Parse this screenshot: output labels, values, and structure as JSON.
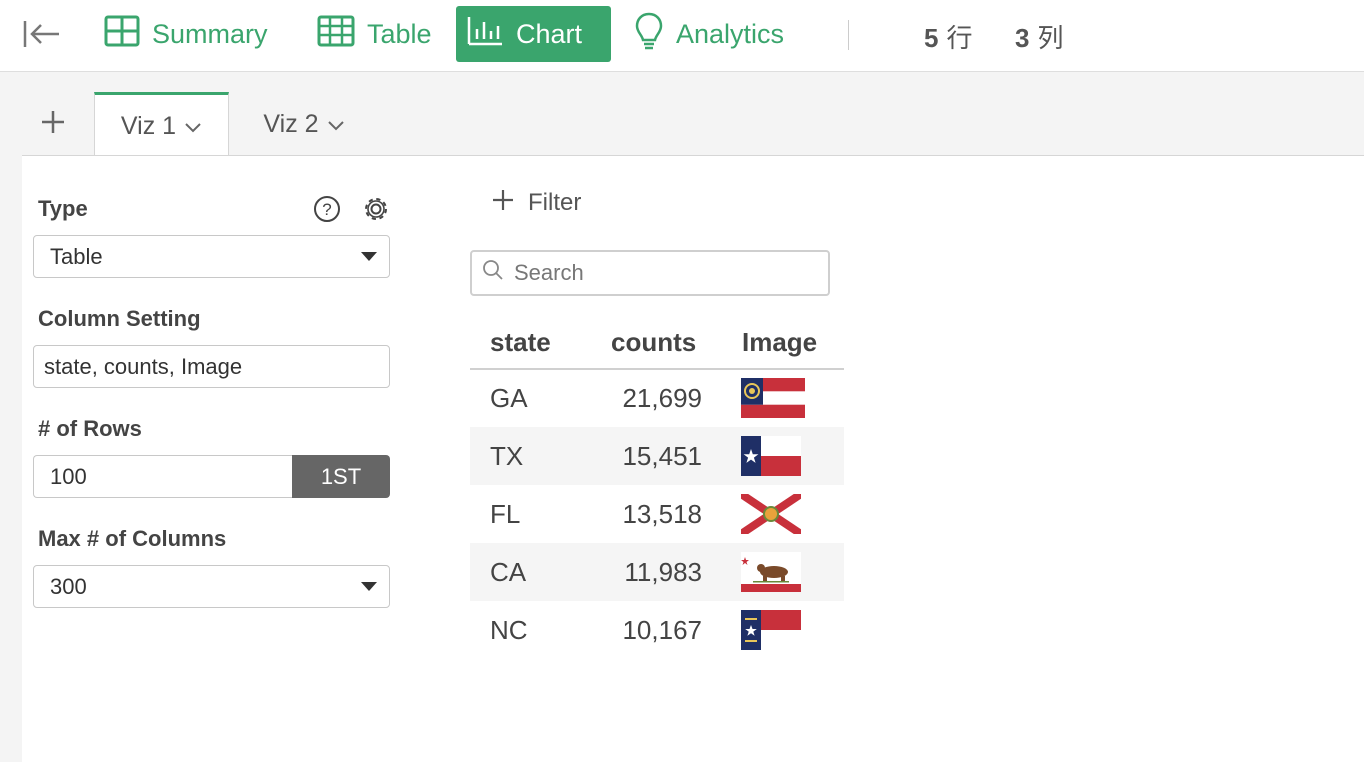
{
  "toolbar": {
    "items": [
      {
        "label": "Summary",
        "icon": "summary-grid-icon"
      },
      {
        "label": "Table",
        "icon": "table-icon"
      },
      {
        "label": "Chart",
        "icon": "chart-bars-icon"
      },
      {
        "label": "Analytics",
        "icon": "lightbulb-icon"
      }
    ],
    "active": "Chart",
    "rows_count": "5",
    "rows_unit": "行",
    "cols_count": "3",
    "cols_unit": "列"
  },
  "tabs": [
    {
      "label": "Viz 1"
    },
    {
      "label": "Viz 2"
    }
  ],
  "config": {
    "type_label": "Type",
    "type_value": "Table",
    "column_setting_label": "Column Setting",
    "column_setting_value": "state, counts, Image",
    "rows_label": "# of Rows",
    "rows_value": "100",
    "rows_button": "1ST",
    "max_cols_label": "Max # of Columns",
    "max_cols_value": "300"
  },
  "filter": {
    "label": "Filter"
  },
  "search": {
    "placeholder": "Search"
  },
  "table": {
    "headers": [
      "state",
      "counts",
      "Image"
    ],
    "rows": [
      {
        "state": "GA",
        "counts": "21,699",
        "flag": "georgia-flag"
      },
      {
        "state": "TX",
        "counts": "15,451",
        "flag": "texas-flag"
      },
      {
        "state": "FL",
        "counts": "13,518",
        "flag": "florida-flag"
      },
      {
        "state": "CA",
        "counts": "11,983",
        "flag": "california-flag"
      },
      {
        "state": "NC",
        "counts": "10,167",
        "flag": "north-carolina-flag"
      }
    ]
  },
  "colors": {
    "accent": "#3aa56d",
    "button_dark": "#666666",
    "flag_red": "#c8303b",
    "flag_blue": "#1f2f66"
  }
}
